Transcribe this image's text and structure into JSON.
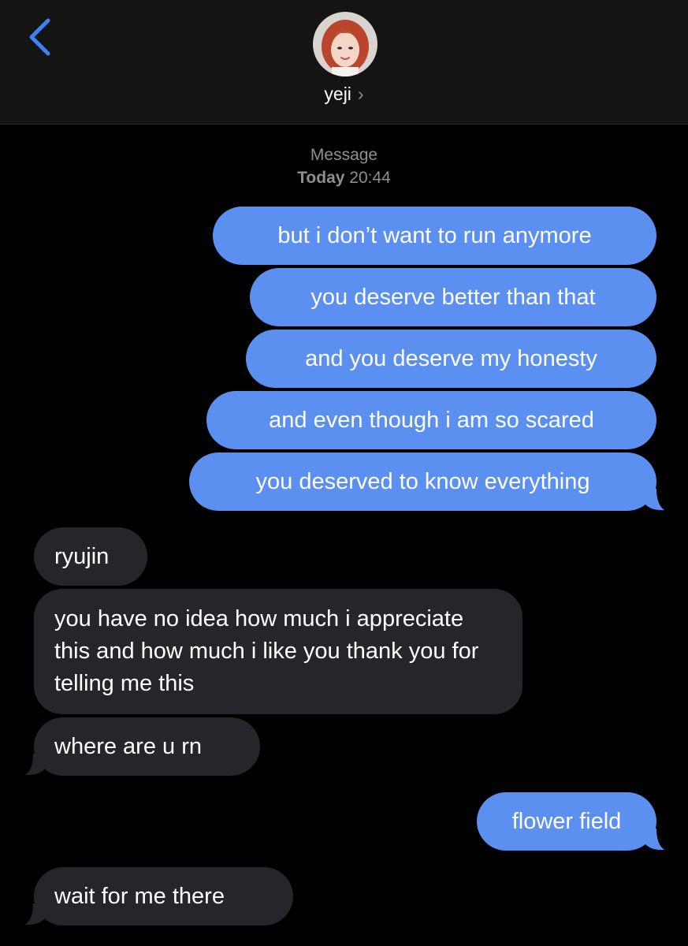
{
  "header": {
    "contact_name": "yeji",
    "chevron": "›",
    "back_icon": "chevron-left-icon",
    "avatar_icon": "contact-avatar"
  },
  "thread": {
    "service": "Message",
    "day": "Today",
    "time": "20:44"
  },
  "messages": [
    {
      "from": "me",
      "text": "but i don’t want to run anymore"
    },
    {
      "from": "me",
      "text": "you deserve better than that"
    },
    {
      "from": "me",
      "text": "and you deserve my honesty"
    },
    {
      "from": "me",
      "text": "and even though i am so scared"
    },
    {
      "from": "me",
      "text": "you deserved to know everything"
    },
    {
      "from": "them",
      "text": "ryujin"
    },
    {
      "from": "them",
      "text": "you have no idea how much i appreciate this and how much i like you thank you for telling me this"
    },
    {
      "from": "them",
      "text": "where are u rn"
    },
    {
      "from": "me",
      "text": "flower field"
    },
    {
      "from": "them",
      "text": "wait for me there"
    }
  ],
  "colors": {
    "outgoing_bubble": "#5b8ff0",
    "incoming_bubble": "#26262a",
    "header_bg": "#141414",
    "accent": "#3b82f6"
  }
}
